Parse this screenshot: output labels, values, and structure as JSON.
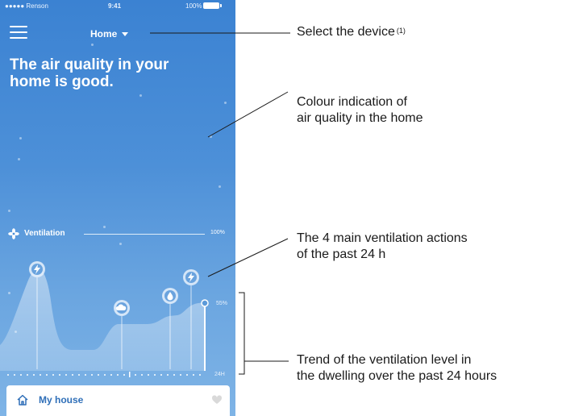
{
  "status_bar": {
    "carrier": "●●●●● Renson",
    "time": "9:41",
    "battery": "100%"
  },
  "header": {
    "device_label": "Home"
  },
  "headline": {
    "line1": "The air quality in your",
    "line2": "home is good."
  },
  "ventilation": {
    "label": "Ventilation",
    "top_pct": "100%",
    "current_pct": "55%",
    "time_span": "24H"
  },
  "actions": [
    {
      "name": "boost",
      "icon": "lightning-icon"
    },
    {
      "name": "humidity",
      "icon": "cloud-icon"
    },
    {
      "name": "moisture",
      "icon": "drop-icon"
    },
    {
      "name": "boost",
      "icon": "lightning-icon"
    }
  ],
  "bottom_bar": {
    "label": "My house",
    "icon": "home-icon",
    "right_icon": "heart-icon"
  },
  "annotations": {
    "device": {
      "text": "Select the device",
      "sup": "(1)"
    },
    "colour": {
      "line1": "Colour indication of",
      "line2": "air quality in the home"
    },
    "actions": {
      "line1": "The 4 main ventilation actions",
      "line2": "of the past 24 h"
    },
    "trend": {
      "line1": "Trend of the ventilation level in",
      "line2": "the dwelling over the past 24 hours"
    }
  },
  "colors": {
    "background_top": "#3b82d2",
    "background_bottom": "#7fb4e6",
    "accent_text": "#2f6fb8"
  }
}
